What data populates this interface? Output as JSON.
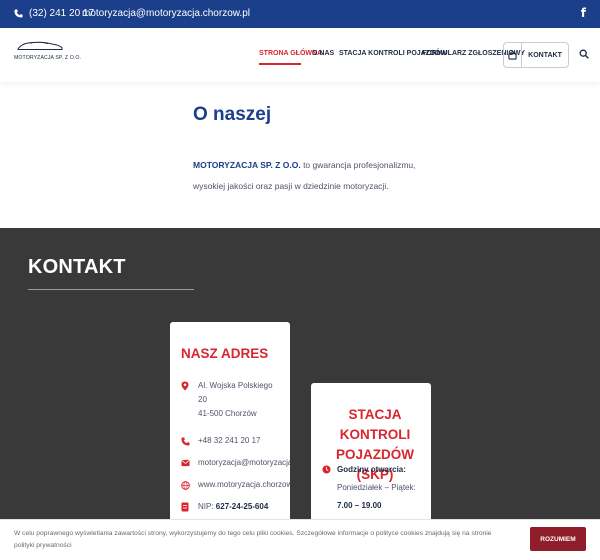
{
  "topbar": {
    "phone": "(32) 241 20 17",
    "email": "motoryzacja@motoryzacja.chorzow.pl",
    "facebook_glyph": "f"
  },
  "navbar": {
    "logo_text": "MOTORYZACJA SP. Z O.O.",
    "items": [
      {
        "label": "STRONA GŁÓWNA",
        "active": true
      },
      {
        "label": "O NAS"
      },
      {
        "label": "STACJA KONTROLI POJAZDÓW"
      },
      {
        "label": "FORMULARZ ZGŁOSZENIOWY"
      }
    ],
    "kontakt_button": "KONTAKT"
  },
  "about": {
    "title": "O naszej",
    "company": "MOTORYZACJA SP. Z O.O.",
    "text_1": "to gwarancja profesjonalizmu,",
    "text_2": "wysokiej jakości oraz pasji w dziedzinie motoryzacji."
  },
  "contact": {
    "heading": "KONTAKT",
    "address_card": {
      "title": "NASZ ADRES",
      "street": "Al. Wojska Polskiego",
      "number": "20",
      "city": "41-500 Chorzów",
      "phone": "+48 32 241 20 17",
      "email": "motoryzacja@motoryzacja.chorzow.pl",
      "website": "www.motoryzacja.chorzow.pl",
      "nip_label": "NIP:",
      "nip_value": "627-24-25-604"
    },
    "skp_card": {
      "title_1": "STACJA KONTROLI",
      "title_2": "POJAZDÓW (SKP)",
      "hours_label": "Godziny otwarcia:",
      "days": "Poniedziałek – Piątek:",
      "hours": "7.00 – 19.00"
    }
  },
  "cookie": {
    "text": "W celu poprawnego wyświetlania zawartości strony, wykorzystujemy do tego celu pliki cookies. Szczegółowe informacje o polityce cookies znajdują się na stronie polityki prywatności",
    "button": "ROZUMIEM"
  },
  "colors": {
    "brand_blue": "#1b3f8b",
    "accent_red": "#d8262f",
    "dark_section": "#393939",
    "cookie_button": "#8f1d2a"
  }
}
